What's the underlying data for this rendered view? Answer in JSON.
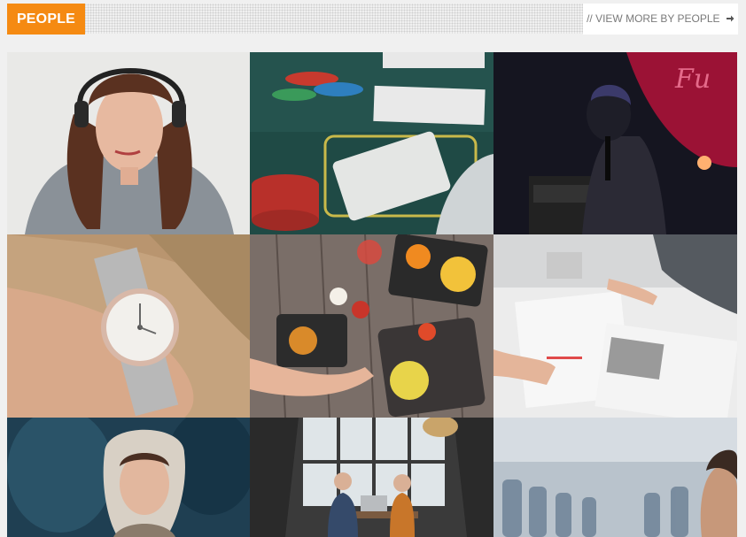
{
  "section": {
    "label": "PEOPLE",
    "label_color": "#f58a12",
    "view_more": "// VIEW MORE BY PEOPLE",
    "view_more_icon": "arrow-right-icon"
  },
  "gallery": {
    "tiles": [
      {
        "subject": "woman-with-headphones"
      },
      {
        "subject": "poker-chips-and-cards"
      },
      {
        "subject": "singer-on-stage"
      },
      {
        "subject": "wristwatch-on-wrist"
      },
      {
        "subject": "food-on-wooden-table"
      },
      {
        "subject": "people-reviewing-printed-layouts"
      },
      {
        "subject": "woman-in-fur-hood"
      },
      {
        "subject": "people-meeting-with-laptop"
      },
      {
        "subject": "airplane-cabin-passenger"
      }
    ]
  }
}
